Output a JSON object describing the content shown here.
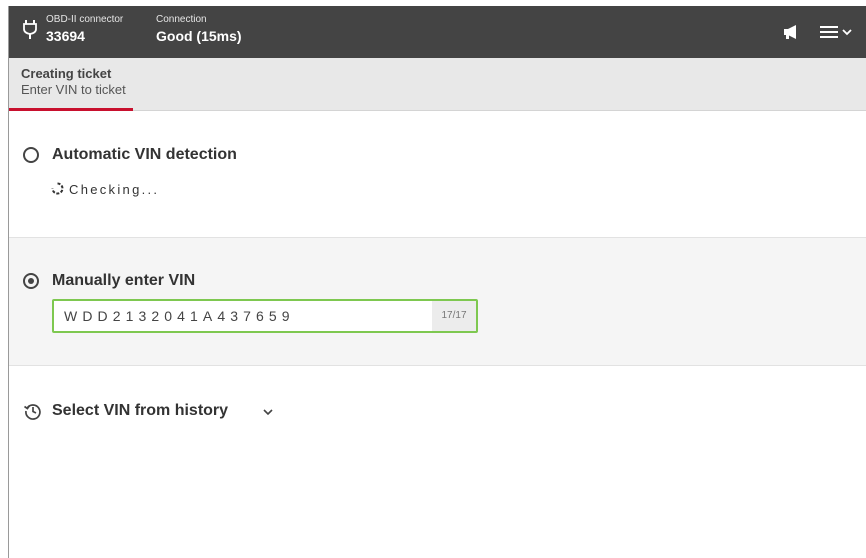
{
  "header": {
    "connector_label": "OBD-II connector",
    "connector_value": "33694",
    "connection_label": "Connection",
    "connection_value": "Good (15ms)",
    "icons": [
      "plug-icon",
      "megaphone-icon",
      "hamburger-menu-icon",
      "chevron-down-icon"
    ]
  },
  "subheader": {
    "title": "Creating ticket",
    "subtitle": "Enter VIN to ticket"
  },
  "options": {
    "automatic": {
      "label": "Automatic VIN detection",
      "selected": false,
      "status": "Checking..."
    },
    "manual": {
      "label": "Manually enter VIN",
      "selected": true,
      "vin_value": "WDD2132041A437659",
      "char_count": "17/17"
    },
    "history": {
      "label": "Select VIN from history"
    }
  },
  "colors": {
    "topbar": "#444444",
    "accent_red": "#c8102e",
    "input_border_valid": "#7ec850"
  }
}
